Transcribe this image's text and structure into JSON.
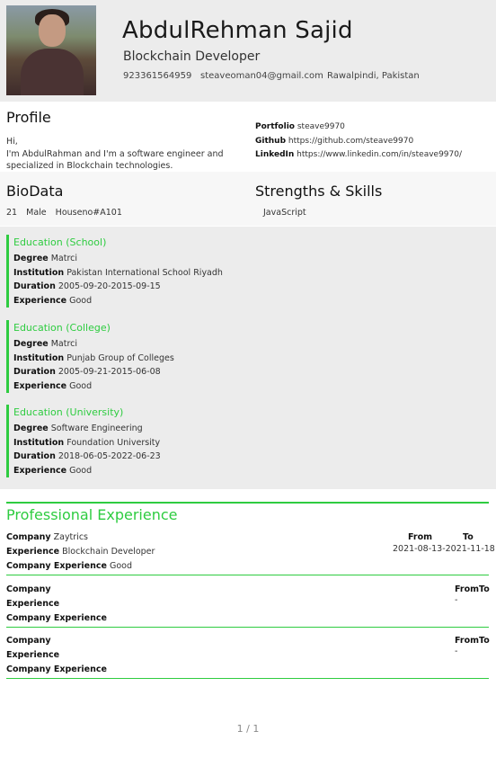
{
  "header": {
    "name": "AbdulRehman Sajid",
    "title": "Blockchain Developer",
    "phone": "923361564959",
    "email": "steaveoman04@gmail.com",
    "location": "Rawalpindi, Pakistan"
  },
  "profile": {
    "heading": "Profile",
    "greeting": "Hi,",
    "text": "I'm AbdulRahman and I'm a software engineer and specialized in Blockchain technologies.",
    "portfolio_label": "Portfolio",
    "portfolio_value": "steave9970",
    "github_label": "Github",
    "github_value": "https://github.com/steave9970",
    "linkedin_label": "LinkedIn",
    "linkedin_value": "https://www.linkedin.com/in/steave9970/"
  },
  "biodata": {
    "heading": "BioData",
    "age": "21",
    "gender": "Male",
    "address": "Houseno#A101"
  },
  "skills": {
    "heading": "Strengths & Skills",
    "items": [
      "JavaScript"
    ]
  },
  "education_labels": {
    "degree": "Degree",
    "institution": "Institution",
    "duration": "Duration",
    "experience": "Experience"
  },
  "education": [
    {
      "heading": "Education (School)",
      "degree": "Matrci",
      "institution": "Pakistan International School Riyadh",
      "duration": "2005-09-20-2015-09-15",
      "experience": "Good"
    },
    {
      "heading": "Education (College)",
      "degree": "Matrci",
      "institution": "Punjab Group of Colleges",
      "duration": "2005-09-21-2015-06-08",
      "experience": "Good"
    },
    {
      "heading": "Education (University)",
      "degree": "Software Engineering",
      "institution": "Foundation University",
      "duration": "2018-06-05-2022-06-23",
      "experience": "Good"
    }
  ],
  "professional": {
    "heading": "Professional Experience",
    "labels": {
      "company": "Company",
      "experience": "Experience",
      "company_experience": "Company Experience",
      "from": "From",
      "to": "To",
      "fromto": "FromTo"
    },
    "entries": [
      {
        "company": "Zaytrics",
        "experience": "Blockchain Developer",
        "company_experience": "Good",
        "dates": "2021-08-13-2021-11-18"
      },
      {
        "company": "",
        "experience": "",
        "company_experience": "",
        "dates": "-"
      },
      {
        "company": "",
        "experience": "",
        "company_experience": "",
        "dates": "-"
      }
    ]
  },
  "pager": "1 / 1"
}
